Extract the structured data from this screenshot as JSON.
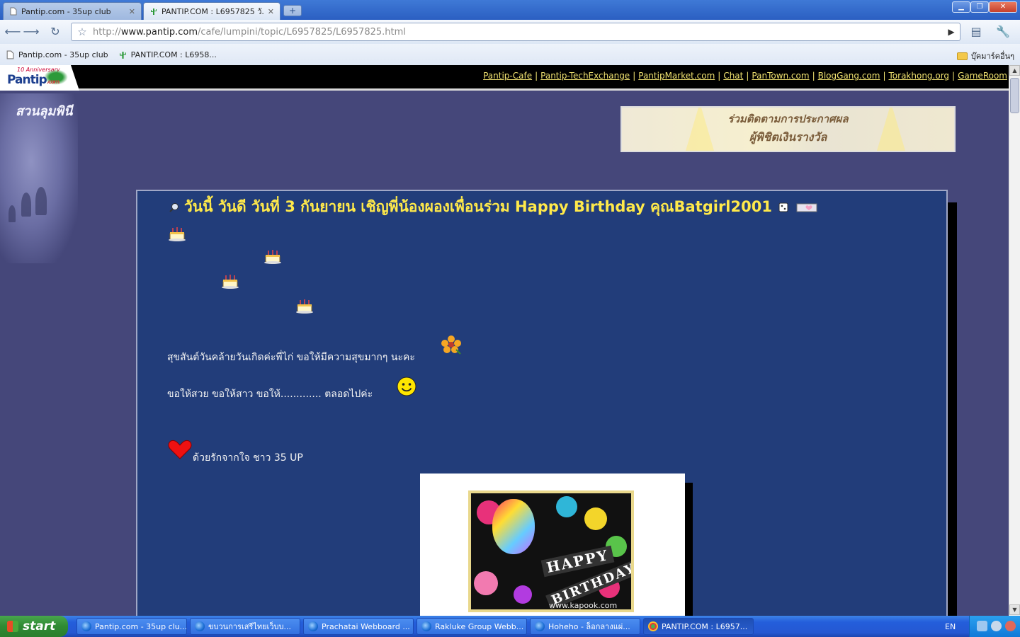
{
  "browser": {
    "tabs": [
      {
        "label": "Pantip.com - 35up club",
        "active": false,
        "icon": "page-icon"
      },
      {
        "label": "PANTIP.COM : L6957825 วั...",
        "active": true,
        "icon": "cactus-icon"
      }
    ],
    "url_prefix": "http://",
    "url_host": "www.pantip.com",
    "url_path": "/cafe/lumpini/topic/L6957825/L6957825.html",
    "bookmarks": [
      {
        "label": "Pantip.com - 35up club",
        "icon": "page-icon"
      },
      {
        "label": "PANTIP.COM : L6958...",
        "icon": "cactus-icon"
      }
    ],
    "other_bookmarks": "บุ๊คมาร์คอื่นๆ"
  },
  "site": {
    "logo_anniversary": "10 Anniversary",
    "logo_name": "Pantip",
    "logo_suffix": ".com",
    "top_links": [
      "Pantip-Cafe",
      "Pantip-TechExchange",
      "PantipMarket.com",
      "Chat",
      "PanTown.com",
      "BlogGang.com",
      "Torakhong.org",
      "GameRoom"
    ],
    "sidebar_title": "สวนลุมพินี",
    "banner_line1": "ร่วมติดตามการประกาศผล",
    "banner_line2": "ผู้พิชิตเงินรางวัล"
  },
  "post": {
    "title": "วันนี้ วันดี วันที่ 3 กันยายน เชิญพี่น้องผองเพื่อนร่วม Happy Birthday คุณBatgirl2001",
    "line1": "สุขสันต์วันคล้ายวันเกิดค่ะพี่ไก่  ขอให้มีความสุขมากๆ นะคะ",
    "line2": "ขอให้สวย ขอให้สาว ขอให้............. ตลอดไปค่ะ",
    "line3": "ด้วยรักจากใจ ชาว 35 UP",
    "card_text1": "HAPPY",
    "card_text2": "BIRTHDAY",
    "card_credit": "www.kapook.com"
  },
  "taskbar": {
    "start": "start",
    "items": [
      {
        "label": "Pantip.com - 35up clu...",
        "active": false
      },
      {
        "label": "ขบวนการเสรีไทยเว็บบ...",
        "active": false
      },
      {
        "label": "Prachatai Webboard ...",
        "active": false
      },
      {
        "label": "Rakluke Group Webb...",
        "active": false
      },
      {
        "label": "Hoheho - ล็อกลางแผ่...",
        "active": false
      },
      {
        "label": "PANTIP.COM : L6957...",
        "active": true
      }
    ],
    "lang": "EN"
  },
  "colors": {
    "page_bg": "#45477a",
    "post_bg": "#223d7a",
    "title_yellow": "#ffe94a",
    "link_yellow": "#f0e270"
  }
}
